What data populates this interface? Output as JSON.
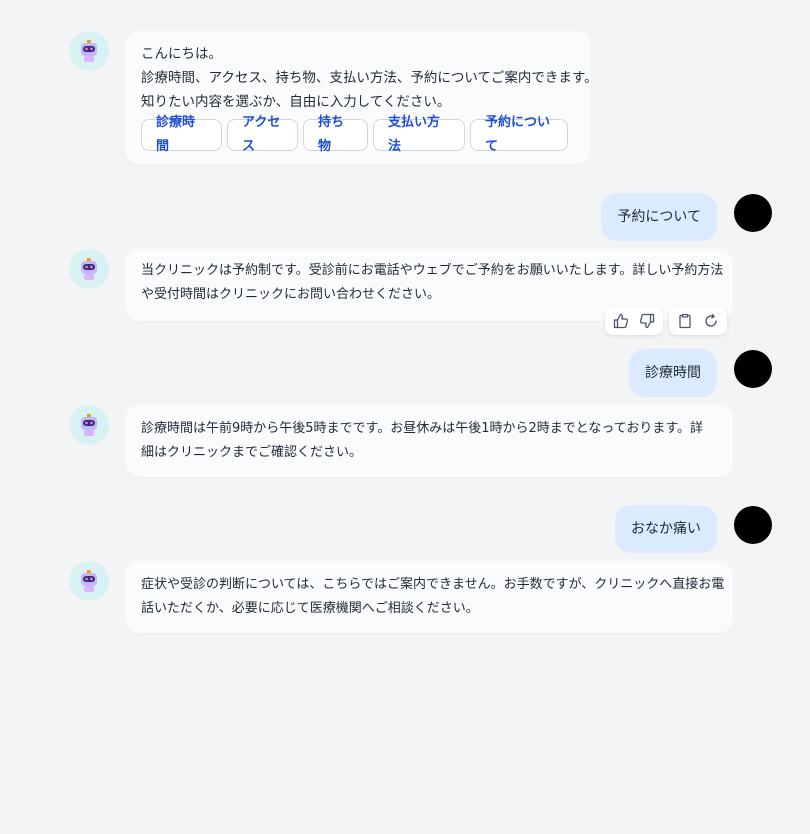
{
  "conversation": [
    {
      "role": "bot",
      "lines": [
        "こんにちは。",
        "診療時間、アクセス、持ち物、支払い方法、予約についてご案内できます。",
        "知りたい内容を選ぶか、自由に入力してください。"
      ],
      "quick_replies": [
        "診療時間",
        "アクセス",
        "持ち物",
        "支払い方法",
        "予約について"
      ]
    },
    {
      "role": "user",
      "text": "予約について"
    },
    {
      "role": "bot",
      "lines": [
        "当クリニックは予約制です。受診前にお電話やウェブでご予約をお願いいたします。詳しい予約方法",
        "や受付時間はクリニックにお問い合わせください。"
      ]
    },
    {
      "role": "user",
      "text": "診療時間"
    },
    {
      "role": "bot",
      "lines": [
        "診療時間は午前9時から午後5時までです。お昼休みは午後1時から2時までとなっております。詳",
        "細はクリニックまでご確認ください。"
      ]
    },
    {
      "role": "user",
      "text": "おなか痛い"
    },
    {
      "role": "bot",
      "lines": [
        "症状や受診の判断については、こちらではご案内できません。お手数ですが、クリニックへ直接お電",
        "話いただくか、必要に応じて医療機関へご相談ください。"
      ]
    }
  ],
  "message_actions": {
    "feedback": [
      "thumbs-up-icon",
      "thumbs-down-icon"
    ],
    "tools": [
      "copy-icon",
      "regenerate-icon"
    ]
  },
  "colors": {
    "background": "#f3f4f6",
    "bot_bubble": "#fafbfc",
    "user_bubble": "#dbeafe",
    "chip_text": "#1d4ed8",
    "bot_avatar_bg": "#d8f1f3",
    "user_avatar": "#000000"
  }
}
